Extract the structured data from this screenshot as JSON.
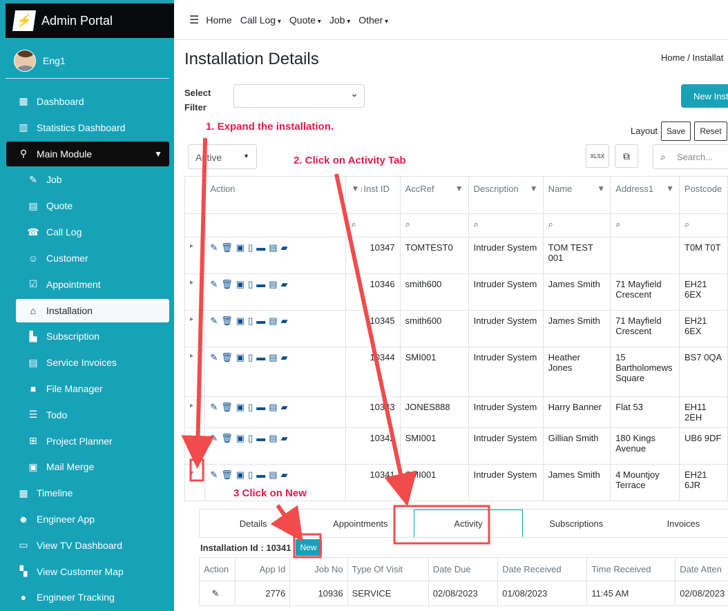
{
  "brand": {
    "title": "Admin Portal"
  },
  "user": {
    "name": "Eng1"
  },
  "sidebar": {
    "items": [
      {
        "label": "Dashboard",
        "icon": "grid-icon"
      },
      {
        "label": "Statistics Dashboard",
        "icon": "bar-chart-icon"
      },
      {
        "label": "Main Module",
        "icon": "plug-icon"
      },
      {
        "label": "Job",
        "icon": "wrench-icon"
      },
      {
        "label": "Quote",
        "icon": "calculator-icon"
      },
      {
        "label": "Call Log",
        "icon": "user-phone-icon"
      },
      {
        "label": "Customer",
        "icon": "users-icon"
      },
      {
        "label": "Appointment",
        "icon": "calendar-check-icon"
      },
      {
        "label": "Installation",
        "icon": "home-icon"
      },
      {
        "label": "Subscription",
        "icon": "file-icon"
      },
      {
        "label": "Service Invoices",
        "icon": "invoice-icon"
      },
      {
        "label": "File Manager",
        "icon": "folder-icon"
      },
      {
        "label": "Todo",
        "icon": "list-icon"
      },
      {
        "label": "Project Planner",
        "icon": "sitemap-icon"
      },
      {
        "label": "Mail Merge",
        "icon": "mail-merge-icon"
      },
      {
        "label": "Timeline",
        "icon": "calendar-icon"
      },
      {
        "label": "Engineer App",
        "icon": "user-gear-icon"
      },
      {
        "label": "View TV Dashboard",
        "icon": "monitor-icon"
      },
      {
        "label": "View Customer Map",
        "icon": "map-icon"
      },
      {
        "label": "Engineer Tracking",
        "icon": "map-marker-icon"
      }
    ]
  },
  "topnav": {
    "items": [
      "Home",
      "Call Log",
      "Quote",
      "Job",
      "Other"
    ]
  },
  "page": {
    "title": "Installation Details",
    "breadcrumb": "Home  /  Installat",
    "select_filter": "Select Filter",
    "new_button": "New Inst",
    "layout": "Layout",
    "save": "Save",
    "reset": "Reset",
    "status": "Active",
    "search_placeholder": "Search..."
  },
  "table": {
    "headers": [
      "Action",
      "Inst ID",
      "AccRef",
      "Description",
      "Name",
      "Address1",
      "Postcode"
    ],
    "rows": [
      [
        "10347",
        "TOMTEST0",
        "Intruder System",
        "TOM TEST 001",
        "",
        "T0M T0T"
      ],
      [
        "10346",
        "smith600",
        "Intruder System",
        "James Smith",
        "71 Mayfield Crescent",
        "EH21 6EX"
      ],
      [
        "10345",
        "smith600",
        "Intruder System",
        "James Smith",
        "71 Mayfield Crescent",
        "EH21 6EX"
      ],
      [
        "10344",
        "SMI001",
        "Intruder System",
        "Heather Jones",
        "15 Bartholomews Square",
        "BS7 0QA"
      ],
      [
        "10343",
        "JONES888",
        "Intruder System",
        "Harry Banner",
        "Flat 53",
        "EH11 2EH"
      ],
      [
        "10342",
        "SMI001",
        "Intruder System",
        "Gillian Smith",
        "180 Kings Avenue",
        "UB6 9DF"
      ],
      [
        "10341",
        "SMI001",
        "Intruder System",
        "James Smith",
        "4 Mountjoy Terrace",
        "EH21 6JR"
      ]
    ]
  },
  "detail": {
    "tabs": [
      "Details",
      "Appointments",
      "Activity",
      "Subscriptions",
      "Invoices"
    ],
    "inst_label": "Installation Id : 10341",
    "new_label": "New",
    "headers": [
      "Action",
      "App Id",
      "Job No",
      "Type Of Visit",
      "Date Due",
      "Date Received",
      "Time Received",
      "Date Atten"
    ],
    "row": [
      "2776",
      "10936",
      "SERVICE",
      "02/08/2023",
      "01/08/2023",
      "11:45 AM",
      "02/08/2023"
    ]
  },
  "annotations": {
    "step1": "1. Expand the installation.",
    "step2": "2. Click on Activity Tab",
    "step3": "3 Click on New"
  },
  "colors": {
    "sidebar": "#17a2b8",
    "brand_bg": "#060a0c",
    "annotation": "#e8174a"
  }
}
